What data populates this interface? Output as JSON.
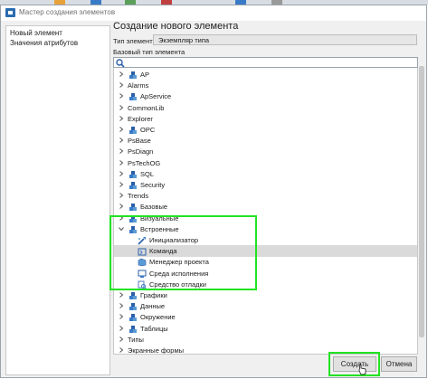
{
  "window": {
    "title": "Мастер создания элементов"
  },
  "nav": {
    "items": [
      "Новый элемент",
      "Значения атрибутов"
    ]
  },
  "main": {
    "heading": "Создание нового элемента",
    "type_label": "Тип элемента",
    "type_value": "Экземпляр типа",
    "base_label": "Базовый тип элемента",
    "search_value": ""
  },
  "tree": {
    "items": [
      {
        "label": "AP",
        "chevron": "right",
        "icon": "cube-icon",
        "depth": 0
      },
      {
        "label": "Alarms",
        "chevron": "right",
        "icon": "",
        "depth": 0
      },
      {
        "label": "ApService",
        "chevron": "right",
        "icon": "cube-icon",
        "depth": 0
      },
      {
        "label": "CommonLib",
        "chevron": "right",
        "icon": "",
        "depth": 0
      },
      {
        "label": "Explorer",
        "chevron": "right",
        "icon": "",
        "depth": 0
      },
      {
        "label": "OPC",
        "chevron": "right",
        "icon": "cube-icon",
        "depth": 0
      },
      {
        "label": "PsBase",
        "chevron": "right",
        "icon": "",
        "depth": 0
      },
      {
        "label": "PsDiagn",
        "chevron": "right",
        "icon": "",
        "depth": 0
      },
      {
        "label": "PsTechOG",
        "chevron": "right",
        "icon": "",
        "depth": 0
      },
      {
        "label": "SQL",
        "chevron": "right",
        "icon": "cube-icon",
        "depth": 0
      },
      {
        "label": "Security",
        "chevron": "right",
        "icon": "cube-icon",
        "depth": 0
      },
      {
        "label": "Trends",
        "chevron": "right",
        "icon": "",
        "depth": 0
      },
      {
        "label": "Базовые",
        "chevron": "right",
        "icon": "cube-icon",
        "depth": 0
      },
      {
        "label": "Визуальные",
        "chevron": "right",
        "icon": "cube-icon",
        "depth": 0
      },
      {
        "label": "Встроенные",
        "chevron": "down",
        "icon": "cube-icon",
        "depth": 0
      },
      {
        "label": "Инициализатор",
        "chevron": "",
        "icon": "initializer-icon",
        "depth": 1
      },
      {
        "label": "Команда",
        "chevron": "",
        "icon": "command-icon",
        "depth": 1,
        "selected": true
      },
      {
        "label": "Менеджер проекта",
        "chevron": "",
        "icon": "project-manager-icon",
        "depth": 1
      },
      {
        "label": "Среда исполнения",
        "chevron": "",
        "icon": "runtime-icon",
        "depth": 1
      },
      {
        "label": "Средство отладки",
        "chevron": "",
        "icon": "debugger-icon",
        "depth": 1
      },
      {
        "label": "Графики",
        "chevron": "right",
        "icon": "cube-icon",
        "depth": 0
      },
      {
        "label": "Данные",
        "chevron": "right",
        "icon": "cube-icon",
        "depth": 0
      },
      {
        "label": "Окружение",
        "chevron": "right",
        "icon": "cube-icon",
        "depth": 0
      },
      {
        "label": "Таблицы",
        "chevron": "right",
        "icon": "cube-icon",
        "depth": 0
      },
      {
        "label": "Типы",
        "chevron": "right",
        "icon": "",
        "depth": 0
      },
      {
        "label": "Экранные формы",
        "chevron": "right",
        "icon": "",
        "depth": 0
      }
    ]
  },
  "buttons": {
    "create": "Создать",
    "cancel": "Отмена"
  },
  "colors": {
    "highlight": "#21e321",
    "selection": "#dadada",
    "icon_blue": "#3a7bc8"
  }
}
